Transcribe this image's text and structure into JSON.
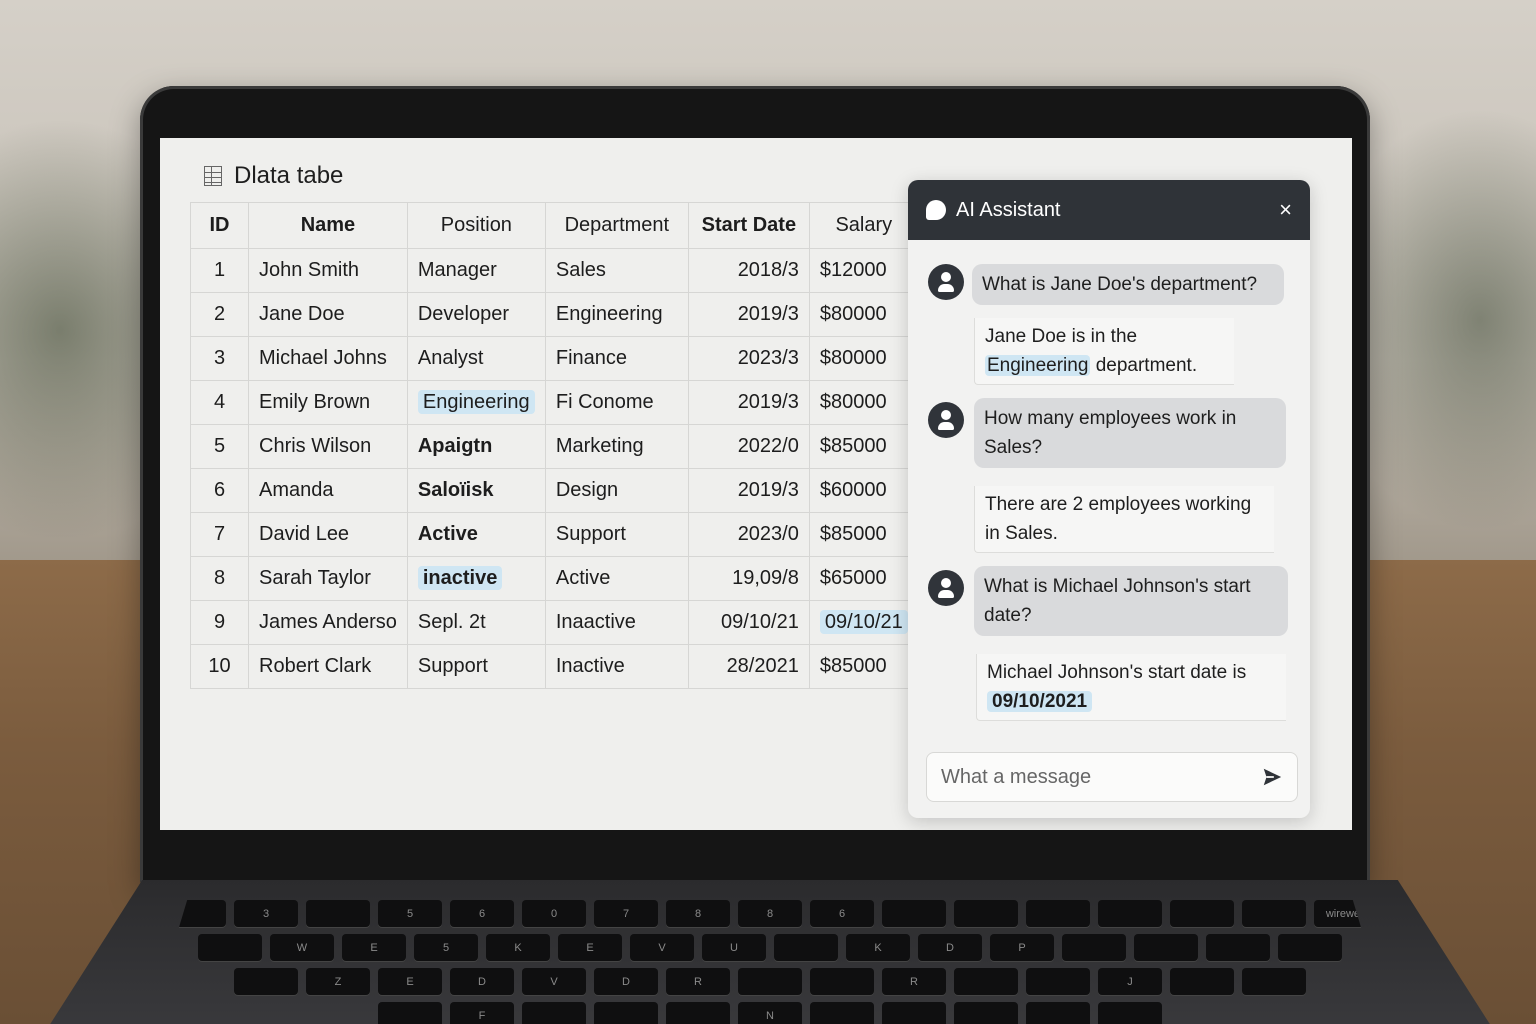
{
  "table": {
    "title": "Dlata tabe",
    "columns": [
      "ID",
      "Name",
      "Position",
      "Department",
      "Start Date",
      "Salary"
    ],
    "rows": [
      [
        "1",
        "John Smith",
        "Manager",
        "Sales",
        "2018/3",
        "$12000"
      ],
      [
        "2",
        "Jane Doe",
        "Developer",
        "Engineering",
        "2019/3",
        "$80000"
      ],
      [
        "3",
        "Michael Johns",
        "Analyst",
        "Finance",
        "2023/3",
        "$80000"
      ],
      [
        "4",
        "Emily Brown",
        "Engineering",
        "Fi Conome",
        "2019/3",
        "$80000"
      ],
      [
        "5",
        "Chris Wilson",
        "Apaigtn",
        "Marketing",
        "2022/0",
        "$85000"
      ],
      [
        "6",
        "Amanda",
        "Saloïisk",
        "Design",
        "2019/3",
        "$60000"
      ],
      [
        "7",
        "David Lee",
        "Active",
        "Support",
        "2023/0",
        "$85000"
      ],
      [
        "8",
        "Sarah Taylor",
        "inactive",
        "Active",
        "19,09/8",
        "$65000"
      ],
      [
        "9",
        "James Anderso",
        "Sepl. 2t",
        "Inaactive",
        "09/10/21",
        "09/10/21"
      ],
      [
        "10",
        "Robert Clark",
        "Support",
        "Inactive",
        "28/2021",
        "$85000"
      ]
    ]
  },
  "assistant": {
    "title": "AI Assistant",
    "close_label": "×",
    "messages": {
      "q1": "What is Jane Doe's department?",
      "a1_pre": "Jane Doe is in the",
      "a1_hl": "Engineering",
      "a1_post": " department.",
      "q2": "How many employees work in Sales?",
      "a2": "There are 2 employees working in Sales.",
      "q3": "What is Michael Johnson's start date?",
      "a3_pre": "Michael Johnson's start date is",
      "a3_hl": "09/10/2021"
    },
    "input_placeholder": "What a message"
  },
  "keyboard": {
    "rows": [
      [
        "",
        "3",
        "",
        "5",
        "6",
        "0",
        "7",
        "8",
        "8",
        "6",
        "",
        "",
        "",
        "",
        "",
        "",
        "wireweg"
      ],
      [
        "",
        "W",
        "E",
        "5",
        "K",
        "E",
        "V",
        "U",
        "",
        "K",
        "D",
        "P",
        "",
        "",
        "",
        ""
      ],
      [
        "",
        "Z",
        "E",
        "D",
        "V",
        "D",
        "R",
        "",
        "",
        "R",
        "",
        "",
        "J",
        "",
        ""
      ],
      [
        "",
        "F",
        "",
        "",
        "",
        "N",
        "",
        "",
        "",
        "",
        ""
      ]
    ]
  }
}
